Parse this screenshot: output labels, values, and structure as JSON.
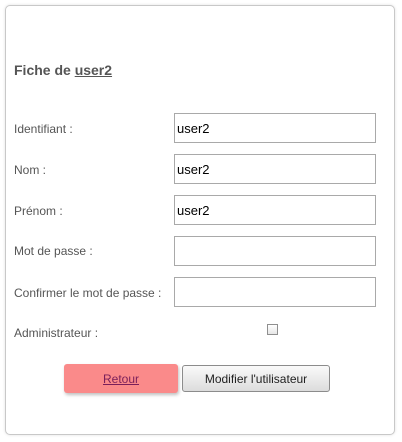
{
  "form": {
    "title_prefix": "Fiche de",
    "title_user": "user2",
    "fields": {
      "identifiant": {
        "label": "Identifiant :",
        "value": "user2"
      },
      "nom": {
        "label": "Nom :",
        "value": "user2"
      },
      "prenom": {
        "label": "Prénom :",
        "value": "user2"
      },
      "mot_de_passe": {
        "label": "Mot de passe :",
        "value": ""
      },
      "confirmer": {
        "label": "Confirmer le mot de passe :",
        "value": ""
      },
      "administrateur": {
        "label": "Administrateur :",
        "checked": false
      }
    },
    "back_label": "Retour",
    "submit_label": "Modifier l'utilisateur"
  },
  "colors": {
    "back_button": "#fa8a8a",
    "text": "#555555",
    "border": "#a9a9a9"
  }
}
